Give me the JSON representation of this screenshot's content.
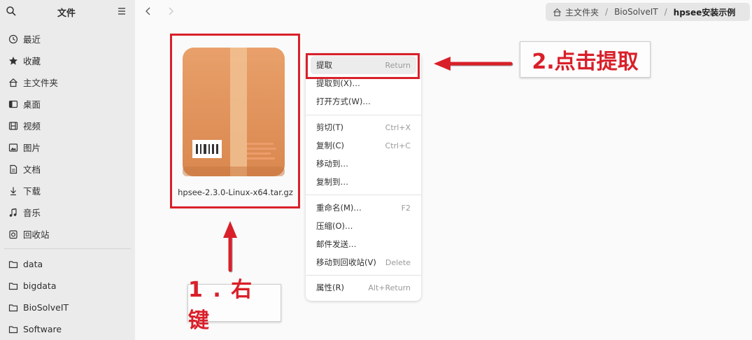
{
  "sidebar": {
    "title": "文件",
    "items": [
      {
        "label": "最近",
        "icon": "clock-icon"
      },
      {
        "label": "收藏",
        "icon": "star-icon"
      },
      {
        "label": "主文件夹",
        "icon": "home-icon"
      },
      {
        "label": "桌面",
        "icon": "desktop-icon"
      },
      {
        "label": "视频",
        "icon": "video-icon"
      },
      {
        "label": "图片",
        "icon": "image-icon"
      },
      {
        "label": "文档",
        "icon": "document-icon"
      },
      {
        "label": "下载",
        "icon": "download-icon"
      },
      {
        "label": "音乐",
        "icon": "music-icon"
      },
      {
        "label": "回收站",
        "icon": "trash-icon"
      }
    ],
    "bookmarks": [
      {
        "label": "data",
        "icon": "folder-icon"
      },
      {
        "label": "bigdata",
        "icon": "folder-icon"
      },
      {
        "label": "BioSolveIT",
        "icon": "folder-icon"
      },
      {
        "label": "Software",
        "icon": "folder-icon"
      }
    ]
  },
  "breadcrumb": {
    "items": [
      "主文件夹",
      "BioSolveIT",
      "hpsee安装示例"
    ],
    "separator": "/"
  },
  "file": {
    "name": "hpsee-2.3.0-Linux-x64.tar.gz",
    "icon": "archive-package-icon"
  },
  "context_menu": {
    "items": [
      {
        "label": "提取",
        "shortcut": "Return",
        "highlighted": true
      },
      {
        "label": "提取到(X)…",
        "shortcut": ""
      },
      {
        "label": "打开方式(W)…",
        "shortcut": ""
      },
      {
        "label": "剪切(T)",
        "shortcut": "Ctrl+X"
      },
      {
        "label": "复制(C)",
        "shortcut": "Ctrl+C"
      },
      {
        "label": "移动到…",
        "shortcut": ""
      },
      {
        "label": "复制到…",
        "shortcut": ""
      },
      {
        "label": "重命名(M)…",
        "shortcut": "F2"
      },
      {
        "label": "压缩(O)…",
        "shortcut": ""
      },
      {
        "label": "邮件发送…",
        "shortcut": ""
      },
      {
        "label": "移动到回收站(V)",
        "shortcut": "Delete"
      },
      {
        "label": "属性(R)",
        "shortcut": "Alt+Return"
      }
    ]
  },
  "annotations": {
    "step1": "1 . 右 键",
    "step2": "2.点击提取"
  },
  "colors": {
    "accent_red": "#d9202a",
    "sidebar_bg": "#ebebeb",
    "content_bg": "#fafafa"
  }
}
